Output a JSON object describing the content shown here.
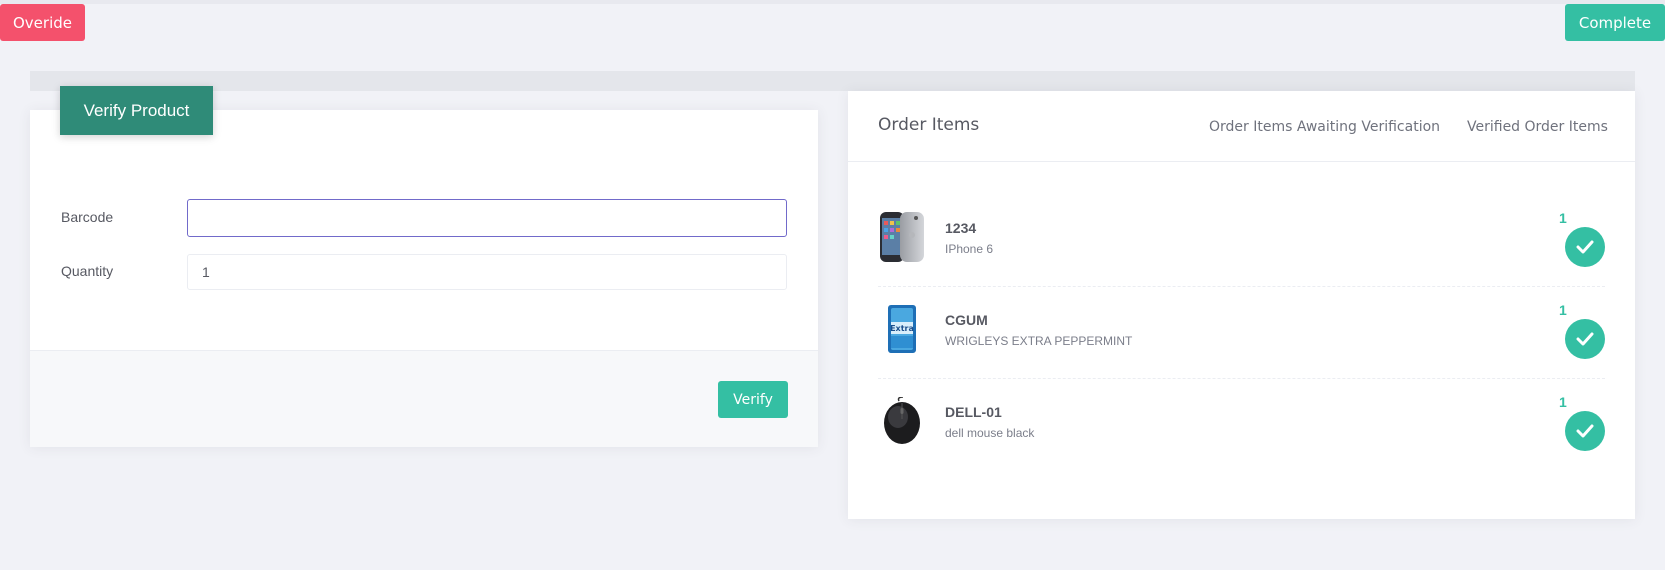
{
  "actions": {
    "override_label": "Overide",
    "complete_label": "Complete"
  },
  "verify_panel": {
    "title": "Verify Product",
    "barcode": {
      "label": "Barcode",
      "value": "",
      "placeholder": ""
    },
    "quantity": {
      "label": "Quantity",
      "value": "1"
    },
    "verify_label": "Verify"
  },
  "order_panel": {
    "title": "Order Items",
    "tabs": [
      "Order Items Awaiting Verification",
      "Verified Order Items"
    ],
    "items": [
      {
        "sku": "1234",
        "name": "IPhone 6",
        "qty": "1",
        "thumb_icon": "iphone-image"
      },
      {
        "sku": "CGUM",
        "name": "WRIGLEYS EXTRA PEPPERMINT",
        "qty": "1",
        "thumb_icon": "gum-pack-image"
      },
      {
        "sku": "DELL-01",
        "name": "dell mouse black",
        "qty": "1",
        "thumb_icon": "mouse-image"
      }
    ]
  },
  "colors": {
    "danger": "#f4516c",
    "success": "#34bfa3",
    "ribbon": "#2f8b78",
    "focus_border": "#716aca"
  }
}
